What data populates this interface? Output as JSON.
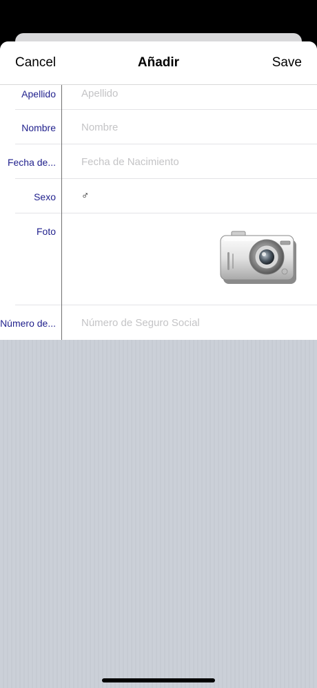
{
  "nav": {
    "cancel_label": "Cancel",
    "title": "Añadir",
    "save_label": "Save"
  },
  "form": {
    "rows": [
      {
        "label": "Apellido",
        "placeholder": "Apellido"
      },
      {
        "label": "Nombre",
        "placeholder": "Nombre"
      },
      {
        "label": "Fecha de...",
        "placeholder": "Fecha de Nacimiento"
      },
      {
        "label": "Sexo",
        "value": "♂"
      },
      {
        "label": "Foto",
        "icon": "camera-icon"
      },
      {
        "label": "Número de...",
        "placeholder": "Número de Seguro Social"
      }
    ]
  },
  "colors": {
    "label": "#1f1f8c",
    "placeholder": "#c4c4c6",
    "background_stripes": "#cbd0d8"
  }
}
